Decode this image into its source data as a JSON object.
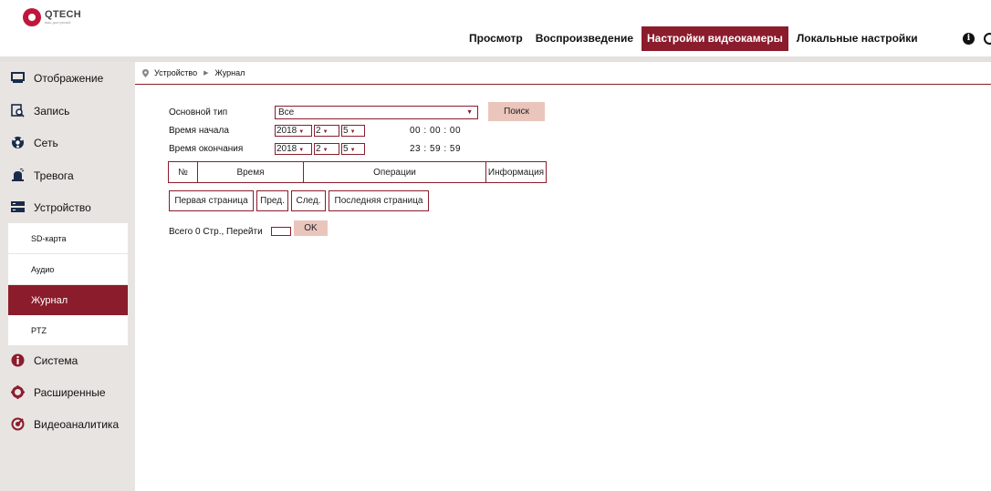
{
  "brand": {
    "name": "QTECH",
    "tagline": "ваш доступный",
    "accent": "#8b1c2c",
    "logo_color": "#c0163c"
  },
  "topnav": [
    {
      "label": "Просмотр",
      "active": false
    },
    {
      "label": "Воспроизведение",
      "active": false
    },
    {
      "label": "Настройки видеокамеры",
      "active": true
    },
    {
      "label": "Локальные настройки",
      "active": false
    }
  ],
  "header_icons": [
    "info-icon",
    "power-icon"
  ],
  "sidebar": {
    "items": [
      {
        "label": "Отображение",
        "icon": "monitor-icon"
      },
      {
        "label": "Запись",
        "icon": "record-search-icon"
      },
      {
        "label": "Сеть",
        "icon": "network-icon"
      },
      {
        "label": "Тревога",
        "icon": "alarm-icon"
      },
      {
        "label": "Устройство",
        "icon": "device-icon"
      }
    ],
    "subitems": [
      {
        "label": "SD-карта",
        "active": false
      },
      {
        "label": "Аудио",
        "active": false
      },
      {
        "label": "Журнал",
        "active": true
      },
      {
        "label": "PTZ",
        "active": false
      }
    ],
    "items_bottom": [
      {
        "label": "Система",
        "icon": "info-icon"
      },
      {
        "label": "Расширенные",
        "icon": "gear-icon"
      },
      {
        "label": "Видеоаналитика",
        "icon": "analytics-icon"
      }
    ]
  },
  "breadcrumb": {
    "parent": "Устройство",
    "current": "Журнал"
  },
  "form": {
    "main_type_label": "Основной тип",
    "main_type_value": "Все",
    "search_button": "Поиск",
    "start_label": "Время начала",
    "start_year": "2018",
    "start_month": "2",
    "start_day": "5",
    "start_time": "00 : 00 : 00",
    "end_label": "Время окончания",
    "end_year": "2018",
    "end_month": "2",
    "end_day": "5",
    "end_time": "23 : 59 : 59"
  },
  "table": {
    "columns": [
      "№",
      "Время",
      "Операции",
      "Информация"
    ]
  },
  "pager": {
    "first": "Первая страница",
    "prev": "Пред.",
    "next": "След.",
    "last": "Последняя страница",
    "total_text": "Всего 0 Стр., Перейти",
    "ok": "OK"
  }
}
